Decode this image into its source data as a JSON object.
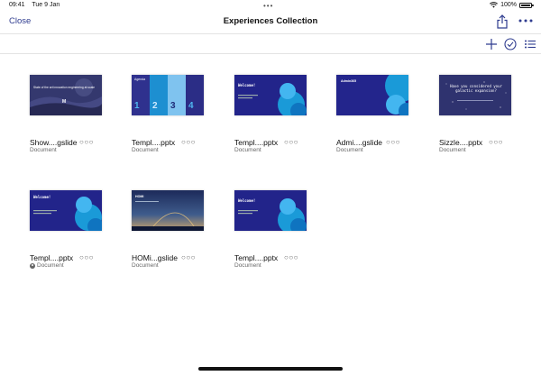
{
  "status": {
    "time": "09:41",
    "date": "Tue 9 Jan",
    "battery": "100%",
    "battery_level": 1.0
  },
  "nav": {
    "close_label": "Close",
    "title": "Experiences Collection"
  },
  "toolbar": {
    "icons": [
      "plus-icon",
      "select-check-icon",
      "list-view-icon"
    ]
  },
  "accent_color": "#2f3c8f",
  "files": [
    {
      "name": "Show....gslide",
      "type": "Document",
      "thumb": "photo-dark",
      "thumb_text": "State of the art innovation engineering at scale",
      "thumb_logo": "M"
    },
    {
      "name": "Templ....pptx",
      "type": "Document",
      "thumb": "agenda",
      "thumb_title": "Agenda",
      "thumb_numbers": [
        "1",
        "2",
        "3",
        "4"
      ]
    },
    {
      "name": "Templ....pptx",
      "type": "Document",
      "thumb": "welcome",
      "thumb_title": "Welcome!"
    },
    {
      "name": "Admi....gslide",
      "type": "Document",
      "thumb": "admin",
      "thumb_title": "Admin365"
    },
    {
      "name": "Sizzle....pptx",
      "type": "Document",
      "thumb": "galactic",
      "thumb_title": "Have you considered your galactic expansion?"
    },
    {
      "name": "Templ....pptx",
      "type": "Document",
      "shared": true,
      "thumb": "welcome2",
      "thumb_title": "Welcome!"
    },
    {
      "name": "HOMi...gslide",
      "type": "Document",
      "thumb": "sky",
      "thumb_title": "HOMI"
    },
    {
      "name": "Templ....pptx",
      "type": "Document",
      "thumb": "welcome",
      "thumb_title": "Welcome!"
    }
  ]
}
